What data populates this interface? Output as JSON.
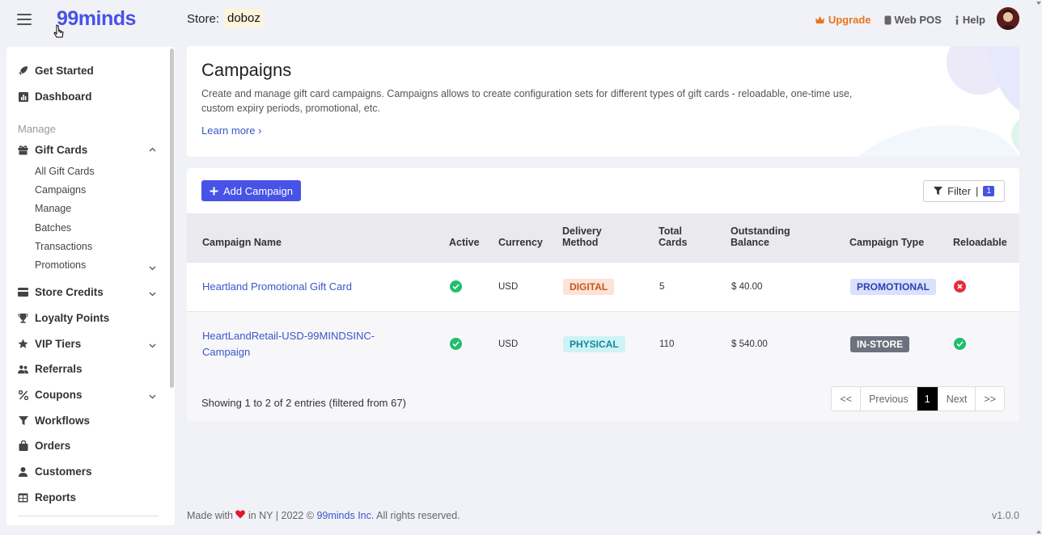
{
  "app": {
    "logo": "99minds"
  },
  "header": {
    "store_label": "Store:",
    "store_name": "doboz",
    "upgrade": "Upgrade",
    "web_pos": "Web POS",
    "help": "Help"
  },
  "sidebar": {
    "get_started": "Get Started",
    "dashboard": "Dashboard",
    "section_manage": "Manage",
    "gift_cards": "Gift Cards",
    "gift_sub": [
      "All Gift Cards",
      "Campaigns",
      "Manage",
      "Batches",
      "Transactions",
      "Promotions"
    ],
    "store_credits": "Store Credits",
    "loyalty_points": "Loyalty Points",
    "vip_tiers": "VIP Tiers",
    "referrals": "Referrals",
    "coupons": "Coupons",
    "workflows": "Workflows",
    "orders": "Orders",
    "customers": "Customers",
    "reports": "Reports"
  },
  "hero": {
    "title": "Campaigns",
    "description": "Create and manage gift card campaigns. Campaigns allows to create configuration sets for different types of gift cards - reloadable, one-time use, custom expiry periods, promotional, etc.",
    "learn_more": "Learn more ›"
  },
  "toolbar": {
    "add_campaign": "Add Campaign",
    "filter": "Filter",
    "filter_separator": "|",
    "filter_count": "1"
  },
  "table": {
    "headers": {
      "name": "Campaign Name",
      "active": "Active",
      "currency": "Currency",
      "delivery_1": "Delivery",
      "delivery_2": "Method",
      "total_1": "Total",
      "total_2": "Cards",
      "balance_1": "Outstanding",
      "balance_2": "Balance",
      "type": "Campaign Type",
      "reloadable": "Reloadable"
    },
    "rows": [
      {
        "name": "Heartland Promotional Gift Card",
        "active": true,
        "currency": "USD",
        "delivery": "DIGITAL",
        "total": "5",
        "balance": "$ 40.00",
        "type": "PROMOTIONAL",
        "reloadable": false
      },
      {
        "name_1": "HeartLandRetail-USD-99MINDSINC-",
        "name_2": "Campaign",
        "active": true,
        "currency": "USD",
        "delivery": "PHYSICAL",
        "total": "110",
        "balance": "$ 540.00",
        "type": "IN-STORE",
        "reloadable": true
      }
    ]
  },
  "pagination": {
    "showing": "Showing 1 to 2 of 2 entries (filtered from 67)",
    "first": "<<",
    "previous": "Previous",
    "current": "1",
    "next": "Next",
    "last": ">>"
  },
  "footer": {
    "made_with": "Made with",
    "in_ny": "in NY | 2022 ©",
    "company": "99minds Inc.",
    "rights": "All rights reserved.",
    "version": "v1.0.0"
  },
  "colors": {
    "brand": "#4752e6",
    "upgrade": "#e8741c",
    "success": "#1fbf6e",
    "danger": "#e52b3b"
  }
}
